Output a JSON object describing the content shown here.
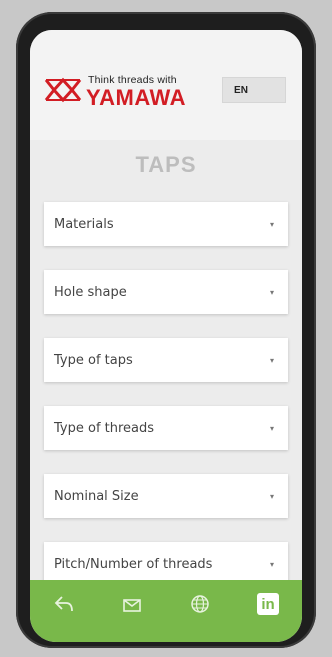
{
  "header": {
    "tagline": "Think threads with",
    "brand": "YAMAWA",
    "language": "EN"
  },
  "page": {
    "title": "TAPS"
  },
  "filters": [
    {
      "label": "Materials"
    },
    {
      "label": "Hole shape"
    },
    {
      "label": "Type of taps"
    },
    {
      "label": "Type of threads"
    },
    {
      "label": "Nominal Size"
    },
    {
      "label": "Pitch/Number of threads"
    }
  ],
  "footer": {
    "icons": [
      "share-icon",
      "mail-icon",
      "globe-icon",
      "linkedin-icon"
    ],
    "linkedin_text": "in"
  },
  "colors": {
    "brand_red": "#d21d24",
    "footer_green": "#79b84a"
  }
}
